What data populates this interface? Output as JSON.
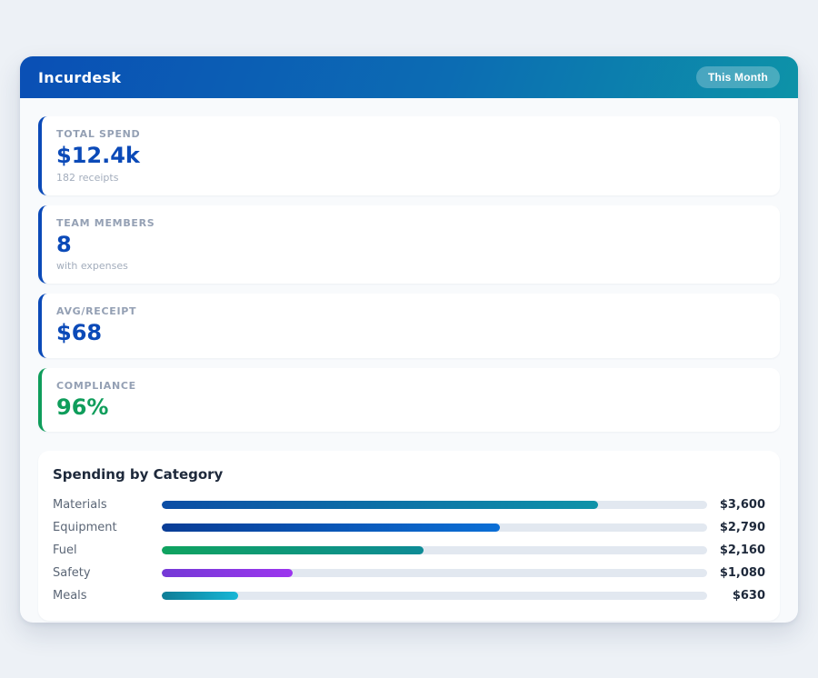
{
  "header": {
    "title": "Incurdesk",
    "badge": "This Month"
  },
  "stats": [
    {
      "label": "TOTAL SPEND",
      "value": "$12.4k",
      "sub": "182 receipts",
      "accent": "#0b4ab8"
    },
    {
      "label": "TEAM MEMBERS",
      "value": "8",
      "sub": "with expenses",
      "accent": "#0b4ab8"
    },
    {
      "label": "AVG/RECEIPT",
      "value": "$68",
      "accent": "#0b4ab8"
    },
    {
      "label": "COMPLIANCE",
      "value": "96%",
      "accent": "#0f9d5b"
    }
  ],
  "chart_data": {
    "type": "bar",
    "orientation": "horizontal",
    "title": "Spending by Category",
    "categories": [
      "Materials",
      "Equipment",
      "Fuel",
      "Safety",
      "Meals"
    ],
    "values": [
      3600,
      2790,
      2160,
      1080,
      630
    ],
    "value_labels": [
      "$3,600",
      "$2,790",
      "$2,160",
      "$1,080",
      "$630"
    ],
    "axis_max": 4500,
    "grid": false,
    "legend": false,
    "track_color": "#e2e8f0",
    "bar_colors": [
      {
        "from": "#0b4da5",
        "to": "#0f93a8"
      },
      {
        "from": "#0a3d96",
        "to": "#0b6fd6"
      },
      {
        "from": "#0fa35f",
        "to": "#0e8b96"
      },
      {
        "from": "#7439d6",
        "to": "#9c36ee"
      },
      {
        "from": "#0e7d96",
        "to": "#16b6d6"
      }
    ]
  },
  "colors": {
    "page_bg": "#edf1f6",
    "panel_bg": "#f8fafc",
    "header_gradient_from": "#0a4fb5",
    "header_gradient_to": "#0d93a8",
    "accent_blue": "#0b4ab8",
    "accent_green": "#0f9d5b",
    "title_navy": "#1e293b"
  }
}
